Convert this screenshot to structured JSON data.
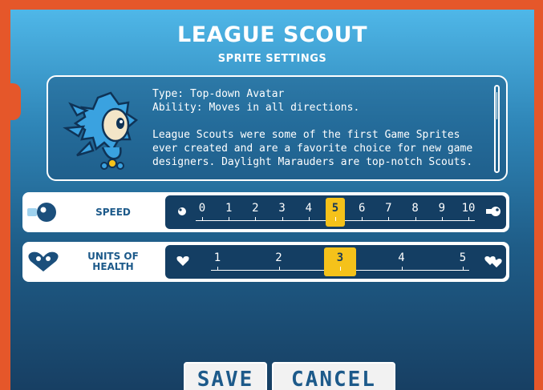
{
  "header": {
    "title": "LEAGUE SCOUT",
    "subtitle": "SPRITE SETTINGS"
  },
  "info": {
    "type_line": "Type: Top-down Avatar",
    "ability_line": "Ability: Moves in all directions.",
    "description_lines": [
      "League Scouts were some of the first Game Sprites",
      "ever created and are a favorite choice for new game",
      "designers. Daylight Marauders are top-notch Scouts."
    ],
    "scroll_position": 0.05
  },
  "speed": {
    "label": "SPEED",
    "ticks": [
      "0",
      "1",
      "2",
      "3",
      "4",
      "5",
      "6",
      "7",
      "8",
      "9",
      "10"
    ],
    "selected_index": 5,
    "selected_value": "5"
  },
  "health": {
    "label_line1": "UNITS OF",
    "label_line2": "HEALTH",
    "ticks": [
      "1",
      "2",
      "3",
      "4",
      "5"
    ],
    "selected_index": 2,
    "selected_value": "3"
  },
  "buttons": {
    "save": "SAVE",
    "cancel": "CANCEL"
  },
  "colors": {
    "frame": "#e5572a",
    "panel_top": "#4fb7e8",
    "panel_bottom": "#173f63",
    "track": "#143e63",
    "selected": "#f5c21a",
    "label": "#1d5a8a"
  }
}
